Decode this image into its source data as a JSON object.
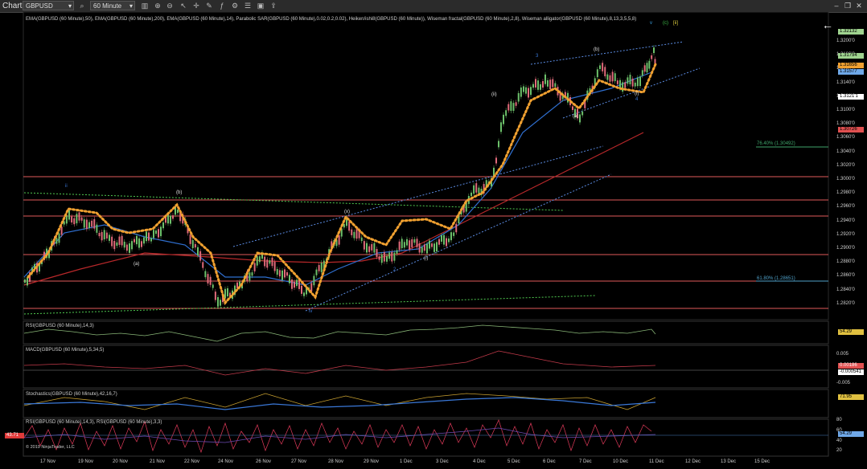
{
  "toolbar": {
    "title": "Chart",
    "instrument": "GBPUSD",
    "interval": "60 Minute",
    "window_buttons": [
      "–",
      "❐",
      "✕"
    ]
  },
  "indicator_header": "EMA(GBPUSD (60 Minute),50), EMA(GBPUSD (60 Minute),200), EMA(GBPUSD (60 Minute),14), Parabolic SAR(GBPUSD (60 Minute),0.02,0.2,0.02), Heiken/ishi8(GBPUSD (60 Minute)), Wiseman fractal(GBPUSD (60 Minute),2,8), Wiseman alligator(GBPUSD (60 Minute),8,13,3,5,5,8)",
  "price_ticks": [
    "1.3200'0",
    "1.3180'0",
    "1.3160'0",
    "1.3140'0",
    "1.3120'0",
    "1.3100'0",
    "1.3080'0",
    "1.3060'0",
    "1.3040'0",
    "1.3020'0",
    "1.3000'0",
    "1.2980'0",
    "1.2960'0",
    "1.2940'0",
    "1.2920'0",
    "1.2900'0",
    "1.2880'0",
    "1.2860'0",
    "1.2840'0",
    "1.2820'0"
  ],
  "price_badges": [
    {
      "text": "1.32132",
      "color": "#9fd38f"
    },
    {
      "text": "1.31794",
      "color": "#9fd38f"
    },
    {
      "text": "1.31656",
      "color": "#f0a030"
    },
    {
      "text": "1.31577",
      "color": "#6fa8e8"
    },
    {
      "text": "1.3121'1",
      "color": "#ffffff"
    },
    {
      "text": "1.30726",
      "color": "#e05050"
    }
  ],
  "fib_labels": [
    "76.40% (1.30492)",
    "61.80% (1.28651)"
  ],
  "rsi_label": "RSI(GBPUSD (60 Minute),14,3)",
  "rsi_value": "54.29",
  "macd_label": "MACD(GBPUSD (60 Minute),5,34,5)",
  "macd_ticks": [
    "0.005",
    "-0.005"
  ],
  "macd_values": [
    "0.00186",
    "-0.000541"
  ],
  "stoch_label": "Stochastics(GBPUSD (60 Minute),42,16,7)",
  "stoch_value": "71.95",
  "rsi2_label": "RSI(GBPUSD (60 Minute),14,3), RSI(GBPUSD (60 Minute),3,3)",
  "rsi2_left_value": "43.71",
  "rsi2_ticks": [
    "80",
    "60",
    "40",
    "20"
  ],
  "rsi2_value": "54.29",
  "copyright": "© 2019 NinjaTrader, LLC",
  "dates": [
    "17 Nov",
    "19 Nov",
    "20 Nov",
    "21 Nov",
    "22 Nov",
    "24 Nov",
    "26 Nov",
    "27 Nov",
    "28 Nov",
    "29 Nov",
    "1 Dec",
    "3 Dec",
    "4 Dec",
    "5 Dec",
    "6 Dec",
    "7 Dec",
    "10 Dec",
    "11 Dec",
    "12 Dec",
    "13 Dec",
    "15 Dec"
  ],
  "wave_labels": [
    "ii",
    "iv",
    "v",
    "(c)",
    "[ii]",
    "3",
    "4",
    "5",
    "(b)",
    "(a)",
    "(i)",
    "(ii)",
    "(iii)",
    "(iv)",
    "b",
    "2",
    "1",
    "ii",
    "iii",
    "iv",
    "(x)",
    "(a)",
    "(b)",
    "(i)"
  ]
}
